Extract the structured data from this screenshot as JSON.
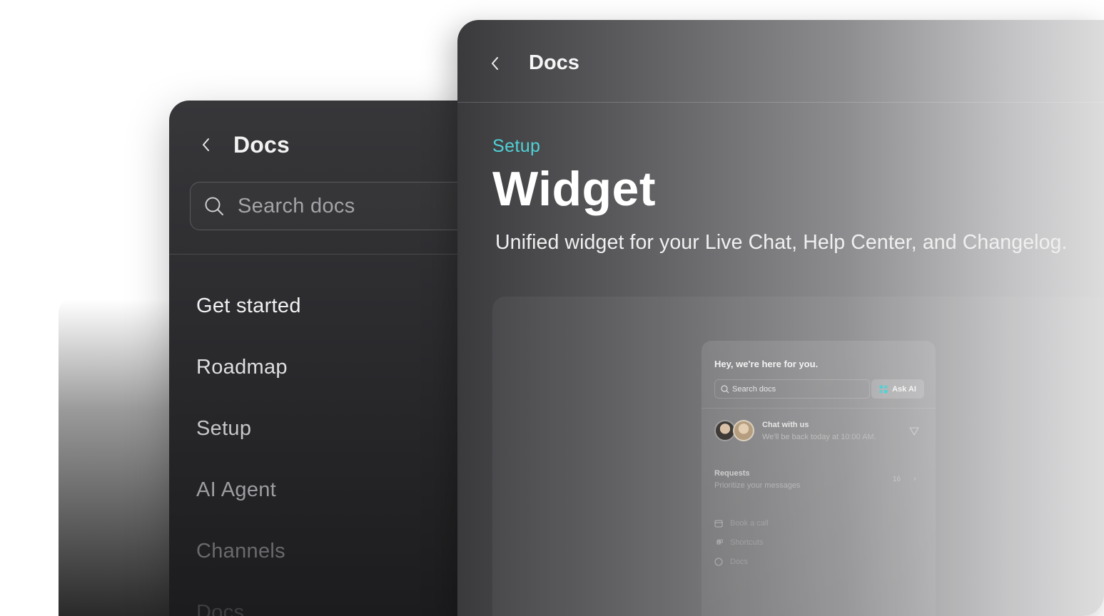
{
  "sidebar": {
    "title": "Docs",
    "search_placeholder": "Search docs",
    "nav_items": [
      {
        "label": "Get started"
      },
      {
        "label": "Roadmap"
      },
      {
        "label": "Setup"
      },
      {
        "label": "AI Agent"
      },
      {
        "label": "Channels"
      },
      {
        "label": "Docs"
      }
    ]
  },
  "main": {
    "title": "Docs",
    "breadcrumb": "Setup",
    "heading": "Widget",
    "subtitle": "Unified widget for your Live Chat, Help Center, and Changelog."
  },
  "widget": {
    "greeting": "Hey, we're here for you.",
    "search_placeholder": "Search docs",
    "ask_ai_label": "Ask AI",
    "chat_title": "Chat with us",
    "chat_subtitle": "We'll be back today at 10:00 AM.",
    "requests_title": "Requests",
    "requests_subtitle": "Prioritize your messages",
    "requests_count": "16",
    "links": [
      {
        "label": "Book a call",
        "icon": "calendar-icon"
      },
      {
        "label": "Shortcuts",
        "icon": "command-icon"
      },
      {
        "label": "Docs",
        "icon": "question-icon"
      }
    ]
  },
  "colors": {
    "accent": "#4fd2d6",
    "panel_dark": "#2b2b2e"
  }
}
